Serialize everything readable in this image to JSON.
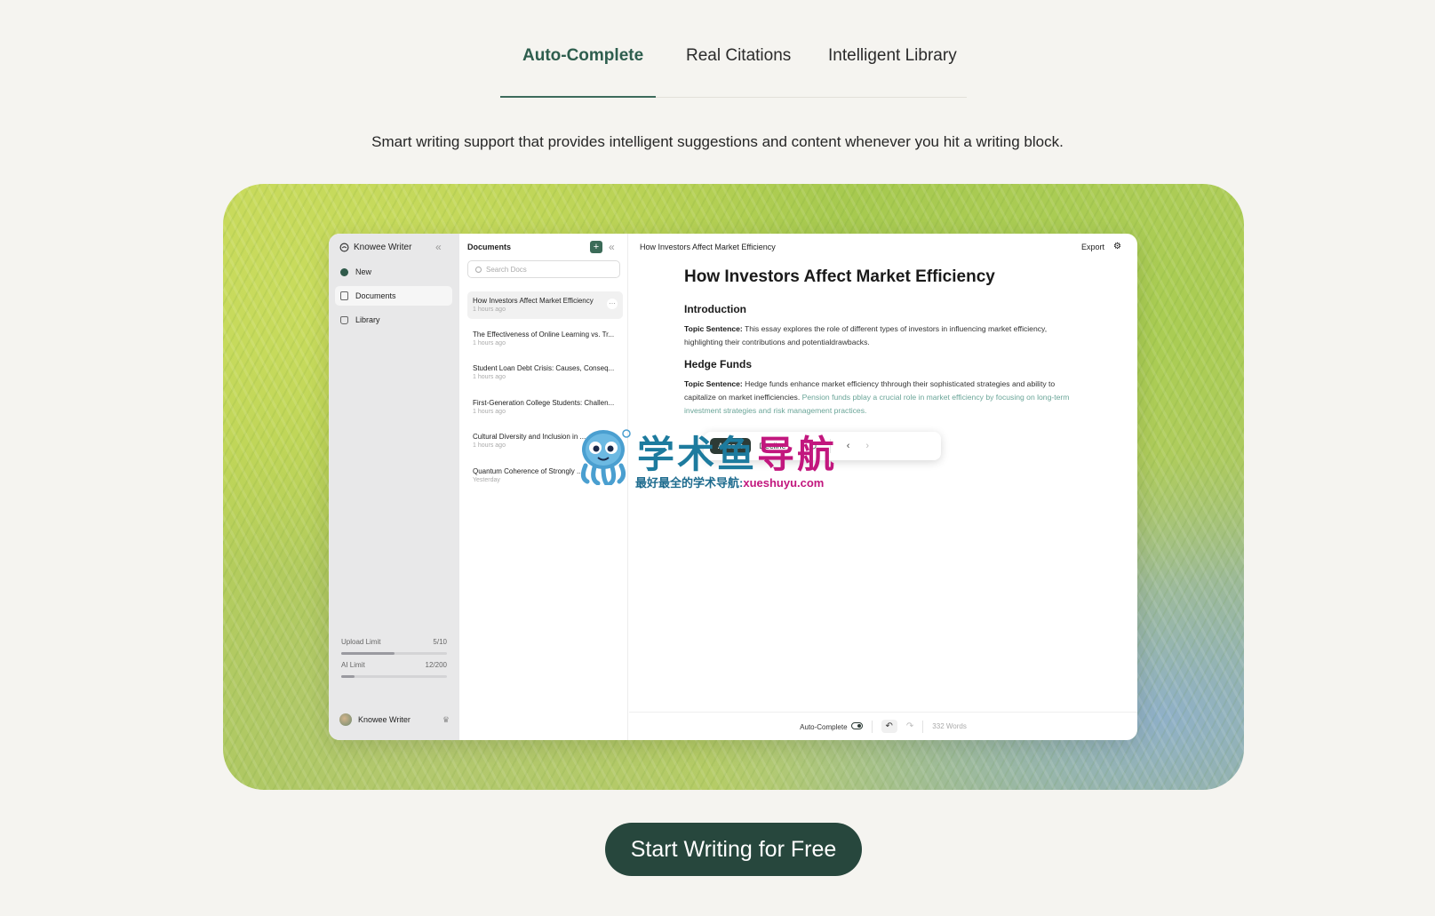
{
  "tabs": [
    {
      "label": "Auto-Complete",
      "active": true
    },
    {
      "label": "Real Citations",
      "active": false
    },
    {
      "label": "Intelligent Library",
      "active": false
    }
  ],
  "tagline": "Smart writing support that provides intelligent suggestions and content whenever you hit a writing block.",
  "app": {
    "brand": "Knowee Writer",
    "nav": [
      {
        "label": "New",
        "icon": "plus-circle-icon"
      },
      {
        "label": "Documents",
        "icon": "document-icon",
        "selected": true
      },
      {
        "label": "Library",
        "icon": "library-icon"
      }
    ],
    "limits": {
      "upload": {
        "label": "Upload Limit",
        "value": "5/10",
        "fraction": 0.5
      },
      "ai": {
        "label": "AI Limit",
        "value": "12/200",
        "fraction": 0.13
      }
    },
    "user": {
      "name": "Knowee Writer"
    },
    "documents": {
      "title": "Documents",
      "search_placeholder": "Search Docs",
      "items": [
        {
          "title": "How Investors Affect Market Efficiency",
          "time": "1 hours ago",
          "selected": true
        },
        {
          "title": "The Effectiveness of Online Learning vs. Tr...",
          "time": "1 hours ago"
        },
        {
          "title": "Student Loan Debt Crisis: Causes, Conseq...",
          "time": "1 hours ago"
        },
        {
          "title": "First-Generation College Students: Challen...",
          "time": "1 hours ago"
        },
        {
          "title": "Cultural Diversity and Inclusion in ...",
          "time": "1 hours ago"
        },
        {
          "title": "Quantum Coherence of Strongly ...",
          "time": "Yesterday"
        }
      ]
    },
    "editor": {
      "header_title": "How Investors Affect Market Efficiency",
      "export_label": "Export",
      "doc_title": "How Investors Affect Market Efficiency",
      "sections": [
        {
          "heading": "Introduction",
          "lead": "Topic Sentence:",
          "text": " This essay explores the role of different types of investors in influencing market efficiency, highlighting their contributions and potentialdrawbacks.",
          "suggestion": ""
        },
        {
          "heading": "Hedge Funds",
          "lead": "Topic Sentence:",
          "text": " Hedge funds enhance market efficiency thhrough their sophisticated strategies and ability to capitalize on market inefficiencies. ",
          "suggestion": "Pension funds pblay a crucial role in market efficiency by focusing on long-term investment strategies and risk management practices."
        }
      ],
      "popup": {
        "accept": "Accept",
        "decline": "Decline"
      },
      "footer": {
        "autocomplete_label": "Auto-Complete",
        "word_count": "332 Words"
      }
    }
  },
  "watermark": {
    "title_part1": "学术鱼",
    "title_part2": "导航",
    "subtitle": "最好最全的学术导航:",
    "url": "xueshuyu.com"
  },
  "cta": {
    "label": "Start Writing for Free"
  },
  "colors": {
    "accent": "#2e5e4e",
    "cta_bg": "#27473d",
    "suggestion": "#6aa598",
    "background": "#f5f4f0"
  }
}
